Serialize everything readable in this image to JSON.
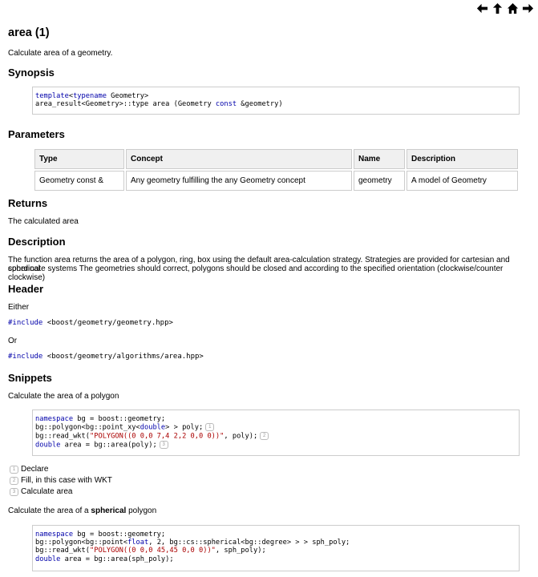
{
  "nav": {
    "icons": [
      "arrow-left-icon",
      "arrow-up-icon",
      "home-icon",
      "arrow-right-icon"
    ]
  },
  "title": "area (1)",
  "summary": "Calculate area of a geometry.",
  "synopsis": {
    "heading": "Synopsis",
    "line1_kw1": "template",
    "line1_lt": "<",
    "line1_kw2": "typename",
    "line1_rest": " Geometry>",
    "line2_a": "area_result<Geometry>::type area (Geometry ",
    "line2_kw": "const",
    "line2_b": " &geometry)"
  },
  "parameters": {
    "heading": "Parameters",
    "columns": [
      "Type",
      "Concept",
      "Name",
      "Description"
    ],
    "rows": [
      [
        "Geometry const &",
        "Any geometry fulfilling the any Geometry concept",
        "geometry",
        "A model of Geometry"
      ]
    ]
  },
  "returns": {
    "heading": "Returns",
    "text": "The calculated area"
  },
  "description": {
    "heading": "Description",
    "line1": "The function area returns the area of a polygon, ring, box using the default area-calculation strategy. Strategies are provided for cartesian and spherical",
    "line2": "coordinate systems The geometries should correct, polygons should be closed and according to the specified orientation (clockwise/counter clockwise)"
  },
  "header": {
    "heading": "Header",
    "either": "Either",
    "include1_kw": "#include",
    "include1_path": " <boost/geometry/geometry.hpp>",
    "or": "Or",
    "include2_kw": "#include",
    "include2_path": " <boost/geometry/algorithms/area.hpp>"
  },
  "snippets": {
    "heading": "Snippets",
    "intro1": "Calculate the area of a polygon",
    "code1": {
      "l1_kw": "namespace",
      "l1_rest": " bg = boost::geometry;",
      "l2_a": "bg::polygon<bg::point_xy<",
      "l2_kw": "double",
      "l2_b": "> > poly;",
      "l3_a": "bg::read_wkt(",
      "l3_str": "\"POLYGON((0 0,0 7,4 2,2 0,0 0))\"",
      "l3_b": ", poly);",
      "l4_kw": "double",
      "l4_rest": " area = bg::area(poly);"
    },
    "callouts": [
      "1",
      "2",
      "3"
    ],
    "callout_labels": [
      "Declare",
      "Fill, in this case with WKT",
      "Calculate area"
    ],
    "intro2_a": "Calculate the area of a ",
    "intro2_b": "spherical",
    "intro2_c": " polygon",
    "code2": {
      "l1_kw": "namespace",
      "l1_rest": " bg = boost::geometry;",
      "l2_a": "bg::polygon<bg::point<",
      "l2_kw": "float",
      "l2_b": ", 2, bg::cs::spherical<bg::degree> > > sph_poly;",
      "l3_a": "bg::read_wkt(",
      "l3_str": "\"POLYGON((0 0,0 45,45 0,0 0))\"",
      "l3_b": ", sph_poly);",
      "l4_kw": "double",
      "l4_rest": " area = bg::area(sph_poly);"
    }
  }
}
